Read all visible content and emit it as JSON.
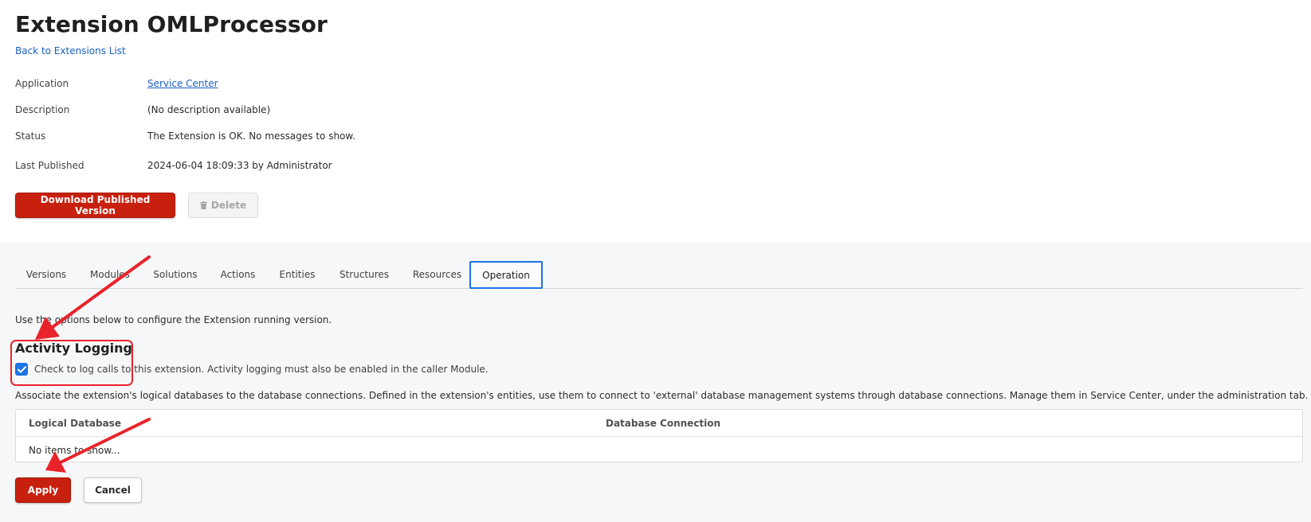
{
  "header": {
    "title": "Extension OMLProcessor",
    "back_link": "Back to Extensions List"
  },
  "details": [
    {
      "label": "Application",
      "value": "Service Center"
    },
    {
      "label": "Description",
      "value": "(No description available)"
    },
    {
      "label": "Status",
      "value": "The Extension is OK. No messages to show."
    },
    {
      "label": "Last Published",
      "value": "2024-06-04 18:09:33 by Administrator"
    }
  ],
  "actions": {
    "download_label": "Download Published Version",
    "delete_label": "Delete",
    "delete_icon": "trash-icon"
  },
  "tabs": [
    {
      "label": "Versions"
    },
    {
      "label": "Modules"
    },
    {
      "label": "Solutions"
    },
    {
      "label": "Actions"
    },
    {
      "label": "Entities"
    },
    {
      "label": "Structures"
    },
    {
      "label": "Resources"
    },
    {
      "label": "Operation",
      "active": true
    }
  ],
  "operation": {
    "intro": "Use the options below to configure the Extension running version.",
    "activity_logging": {
      "title": "Activity Logging",
      "checkbox_label": "Check to log calls to this extension. Activity logging must also be enabled in the caller Module.",
      "checked": true
    },
    "association_text": "Associate the extension's logical databases to the database connections. Defined in the extension's entities, use them to connect to 'external' database management systems through database connections. Manage them in Service Center, under the administration tab.",
    "table": {
      "columns": [
        "Logical Database",
        "Database Connection"
      ],
      "empty_text": "No items to show..."
    },
    "apply_label": "Apply",
    "cancel_label": "Cancel"
  },
  "colors": {
    "primary": "#c8200e",
    "link": "#1a5fc2",
    "focus": "#1a73e8",
    "annotation": "#e8242a"
  }
}
